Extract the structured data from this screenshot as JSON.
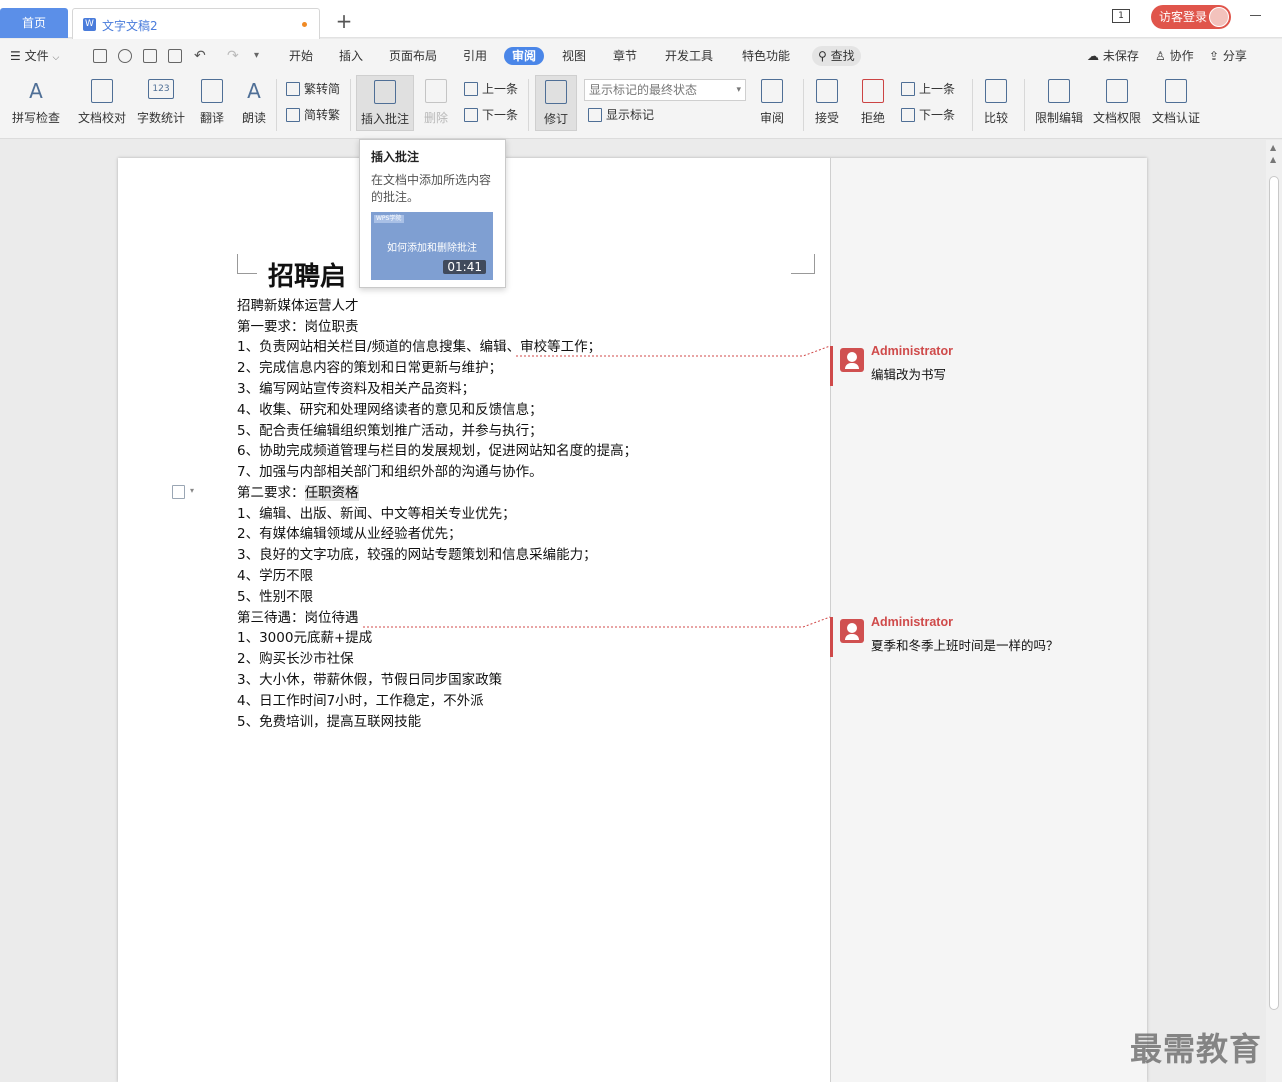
{
  "tabs": {
    "home": "首页",
    "doc": "文字文稿2",
    "add": "+"
  },
  "titlebar": {
    "window_icon": "1",
    "login": "访客登录"
  },
  "menu": {
    "file": "文件",
    "items": [
      "开始",
      "插入",
      "页面布局",
      "引用",
      "审阅",
      "视图",
      "章节",
      "开发工具",
      "特色功能"
    ],
    "active": "审阅",
    "search": "查找",
    "unsaved": "未保存",
    "collab": "协作",
    "share": "分享"
  },
  "ribbon": {
    "spell": "拼写检查",
    "proof": "文档校对",
    "wordcount": "字数统计",
    "translate": "翻译",
    "read": "朗读",
    "trad": "繁转简",
    "simp": "简转繁",
    "insert_comment": "插入批注",
    "delete": "删除",
    "prev": "上一条",
    "next": "下一条",
    "revise": "修订",
    "display_state": "显示标记的最终状态",
    "show_marks": "显示标记",
    "review": "审阅",
    "accept": "接受",
    "reject": "拒绝",
    "prev2": "上一条",
    "next2": "下一条",
    "compare": "比较",
    "restrict": "限制编辑",
    "permission": "文档权限",
    "certify": "文档认证"
  },
  "tooltip": {
    "title": "插入批注",
    "desc": "在文档中添加所选内容的批注。",
    "thumb_logo": "WPS学院",
    "thumb_caption": "如何添加和删除批注",
    "duration": "01:41"
  },
  "document": {
    "title": "招聘启",
    "lines": [
      "招聘新媒体运营人才",
      "第一要求：岗位职责",
      "1、负责网站相关栏目/频道的信息搜集、编辑、审校等工作；",
      "2、完成信息内容的策划和日常更新与维护；",
      "3、编写网站宣传资料及相关产品资料；",
      "4、收集、研究和处理网络读者的意见和反馈信息；",
      "5、配合责任编辑组织策划推广活动，并参与执行；",
      "6、协助完成频道管理与栏目的发展规划，促进网站知名度的提高；",
      "7、加强与内部相关部门和组织外部的沟通与协作。",
      "第二要求：",
      "1、编辑、出版、新闻、中文等相关专业优先；",
      "2、有媒体编辑领域从业经验者优先；",
      "3、良好的文字功底，较强的网站专题策划和信息采编能力；",
      "4、学历不限",
      "5、性别不限",
      "第三待遇：岗位待遇",
      "1、3000元底薪+提成",
      "2、购买长沙市社保",
      "3、大小休，带薪休假，节假日同步国家政策",
      "4、日工作时间7小时，工作稳定，不外派",
      "5、免费培训，提高互联网技能"
    ],
    "highlight": "任职资格"
  },
  "comments": [
    {
      "author": "Administrator",
      "text": "编辑改为书写"
    },
    {
      "author": "Administrator",
      "text": "夏季和冬季上班时间是一样的吗？"
    }
  ],
  "watermark": "最需教育",
  "colors": {
    "accent": "#4a86e8",
    "comment": "#cf4a4a",
    "login": "#e0554b"
  }
}
